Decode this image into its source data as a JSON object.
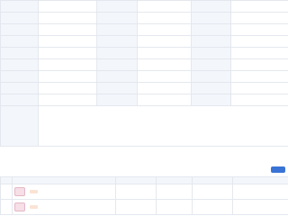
{
  "table_rows": [
    {
      "c": [
        "",
        "",
        "",
        "",
        "",
        ""
      ]
    },
    {
      "c": [
        "",
        "",
        "",
        "",
        "",
        ""
      ]
    },
    {
      "c": [
        "",
        "",
        "",
        "",
        "",
        ""
      ]
    },
    {
      "c": [
        "",
        "",
        "",
        "",
        "",
        ""
      ]
    },
    {
      "c": [
        "",
        "",
        "",
        "",
        "",
        ""
      ]
    },
    {
      "c": [
        "",
        "",
        "",
        "",
        "",
        ""
      ]
    },
    {
      "c": [
        "",
        "",
        "",
        "",
        "",
        ""
      ]
    },
    {
      "c": [
        "",
        "",
        "",
        "",
        "",
        ""
      ]
    },
    {
      "c": [
        "",
        "",
        "",
        "",
        "",
        ""
      ]
    }
  ],
  "scope": {
    "label": "",
    "text": ""
  },
  "share_section": {
    "title": "",
    "action": ""
  },
  "shares": {
    "headers": [
      "",
      "",
      "",
      "",
      "",
      ""
    ],
    "rows": [
      {
        "c": [
          "",
          "",
          "",
          "",
          "",
          ""
        ]
      },
      {
        "c": [
          "",
          "",
          "",
          "",
          "",
          ""
        ]
      }
    ]
  },
  "colors": {
    "accent": "#3a73d6",
    "label_bg": "#f3f6fb",
    "border": "#e4e8ee",
    "seal": "#f6dfe6"
  }
}
